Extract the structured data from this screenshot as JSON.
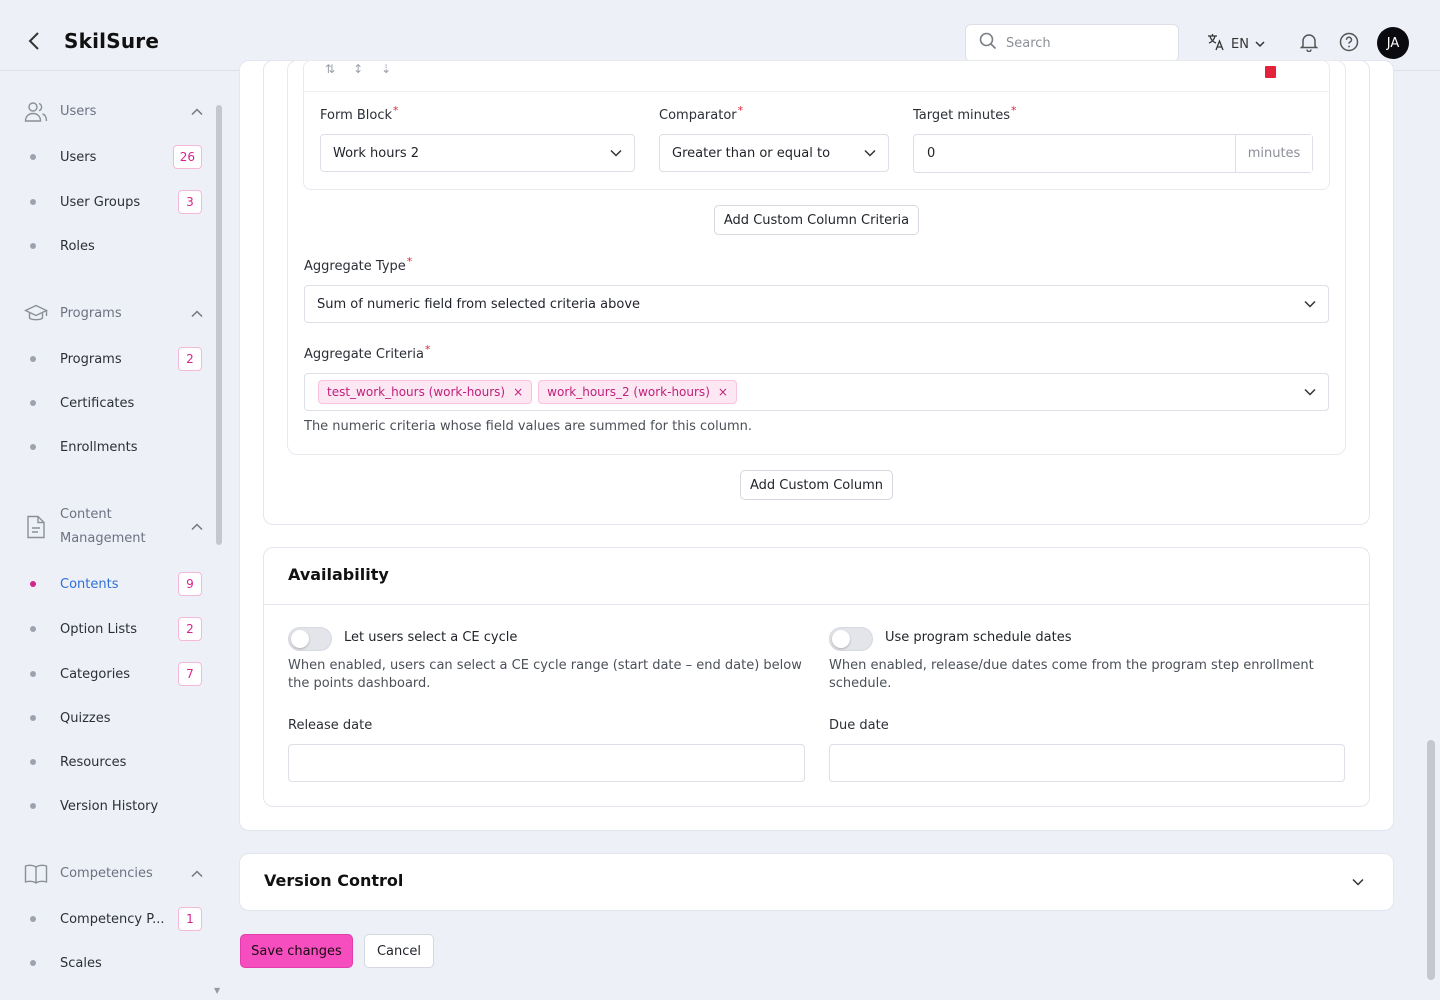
{
  "header": {
    "brand": "SkilSure",
    "search_placeholder": "Search",
    "language": "EN",
    "avatar_initials": "JA"
  },
  "sidebar": {
    "sections": [
      {
        "label": "Users",
        "icon": "users-icon",
        "items": [
          {
            "label": "Users",
            "badge": "26"
          },
          {
            "label": "User Groups",
            "badge": "3"
          },
          {
            "label": "Roles",
            "badge": ""
          }
        ]
      },
      {
        "label": "Programs",
        "icon": "graduation-cap-icon",
        "items": [
          {
            "label": "Programs",
            "badge": "2"
          },
          {
            "label": "Certificates",
            "badge": ""
          },
          {
            "label": "Enrollments",
            "badge": ""
          }
        ]
      },
      {
        "label": "Content Management",
        "label_line1": "Content",
        "label_line2": "Management",
        "icon": "document-icon",
        "items": [
          {
            "label": "Contents",
            "badge": "9",
            "active": true
          },
          {
            "label": "Option Lists",
            "badge": "2"
          },
          {
            "label": "Categories",
            "badge": "7"
          },
          {
            "label": "Quizzes",
            "badge": ""
          },
          {
            "label": "Resources",
            "badge": ""
          },
          {
            "label": "Version History",
            "badge": ""
          }
        ]
      },
      {
        "label": "Competencies",
        "icon": "book-open-icon",
        "items": [
          {
            "label": "Competency P...",
            "badge": "1"
          },
          {
            "label": "Scales",
            "badge": ""
          }
        ]
      }
    ]
  },
  "criteria": {
    "form_block_label": "Form Block",
    "form_block_value": "Work hours 2",
    "comparator_label": "Comparator",
    "comparator_value": "Greater than or equal to",
    "target_label": "Target minutes",
    "target_value": "0",
    "target_suffix": "minutes",
    "add_criteria_button": "Add Custom Column Criteria"
  },
  "aggregate": {
    "type_label": "Aggregate Type",
    "type_value": "Sum of numeric field from selected criteria above",
    "criteria_label": "Aggregate Criteria",
    "tags": [
      "test_work_hours (work-hours)",
      "work_hours_2 (work-hours)"
    ],
    "help_text": "The numeric criteria whose field values are summed for this column.",
    "add_column_button": "Add Custom Column"
  },
  "availability": {
    "title": "Availability",
    "ce_toggle_label": "Let users select a CE cycle",
    "ce_desc": "When enabled, users can select a CE cycle range (start date – end date) below the points dashboard.",
    "schedule_toggle_label": "Use program schedule dates",
    "schedule_desc": "When enabled, release/due dates come from the program step enrollment schedule.",
    "release_label": "Release date",
    "release_value": "",
    "due_label": "Due date",
    "due_value": ""
  },
  "version_control": {
    "title": "Version Control"
  },
  "actions": {
    "save": "Save changes",
    "cancel": "Cancel"
  },
  "colors": {
    "accent": "#f64dbf",
    "badge_text": "#d6248d",
    "active_link": "#2f6fd6",
    "required": "#e4233a"
  }
}
